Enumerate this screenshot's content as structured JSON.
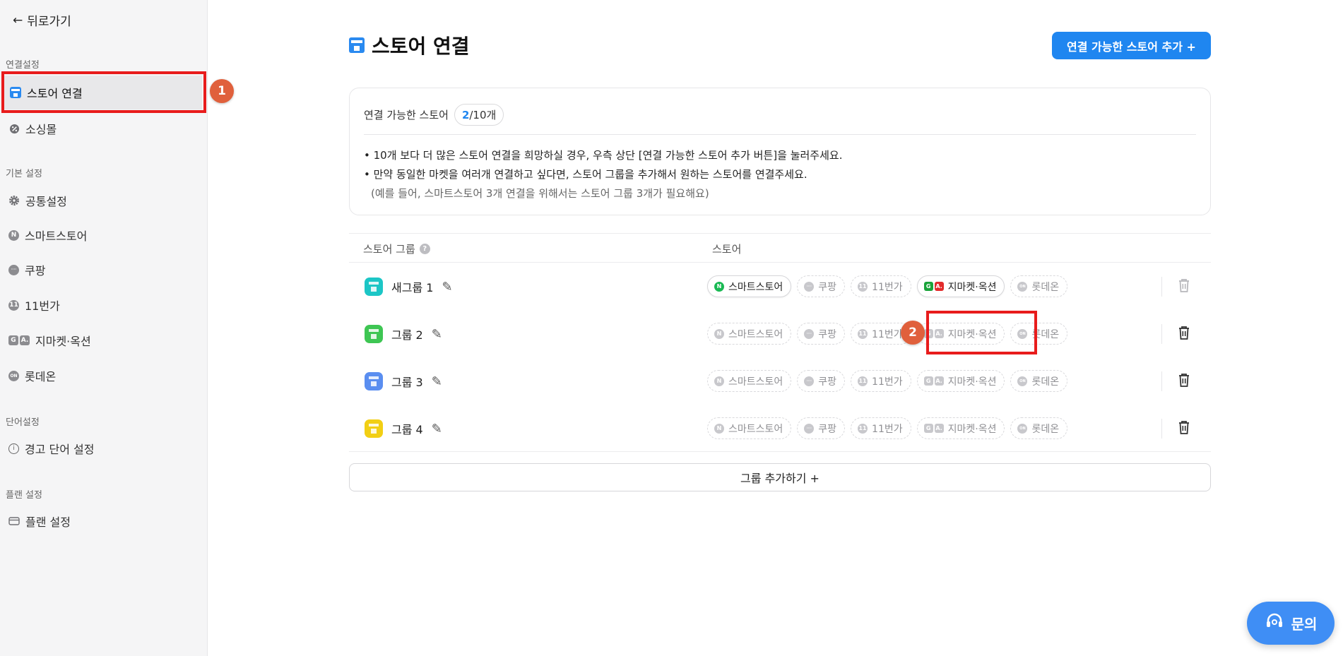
{
  "sidebar": {
    "back_label": "뒤로가기",
    "sections": [
      {
        "label": "연결설정"
      },
      {
        "label": "기본 설정"
      },
      {
        "label": "단어설정"
      },
      {
        "label": "플랜 설정"
      }
    ],
    "items": [
      {
        "label": "스토어 연결",
        "icon": "store-icon",
        "active": true
      },
      {
        "label": "소싱몰",
        "icon": "sourcing-icon"
      },
      {
        "label": "공통설정",
        "icon": "gear-icon"
      },
      {
        "label": "스마트스토어",
        "icon": "naver-icon",
        "icon_text": "N"
      },
      {
        "label": "쿠팡",
        "icon": "coupang-icon"
      },
      {
        "label": "11번가",
        "icon": "11st-icon",
        "icon_text": "11"
      },
      {
        "label": "지마켓·옥션",
        "icon": "gmarket-auction-icon",
        "icon_text": "G",
        "icon_text2": "A."
      },
      {
        "label": "롯데온",
        "icon": "lotteon-icon",
        "icon_text": "ON"
      },
      {
        "label": "경고 단어 설정",
        "icon": "info-icon",
        "icon_text": "i"
      },
      {
        "label": "플랜 설정",
        "icon": "card-icon"
      }
    ]
  },
  "annotations": {
    "marker1": "1",
    "marker2": "2"
  },
  "header": {
    "title": "스토어 연결",
    "add_button": "연결 가능한 스토어 추가 +"
  },
  "info": {
    "label": "연결 가능한 스토어",
    "current": "2",
    "max": "/10개",
    "lines": [
      "• 10개 보다 더 많은 스토어 연결을 희망하실 경우, 우측 상단 [연결 가능한 스토어 추가 버튼]을 눌러주세요.",
      "• 만약 동일한 마켓을 여러개 연결하고 싶다면, 스토어 그룹을 추가해서 원하는 스토어를 연결주세요."
    ],
    "example": "(예를 들어, 스마트스토어 3개 연결을 위해서는 스토어 그룹 3개가 필요해요)"
  },
  "table": {
    "col_group": "스토어 그룹",
    "col_group_help": "?",
    "col_store": "스토어",
    "store_labels": [
      "스마트스토어",
      "쿠팡",
      "11번가",
      "지마켓·옥션",
      "롯데온"
    ],
    "rows": [
      {
        "name": "새그룹 1",
        "color": "#1cc6c6",
        "connected": [
          "naver",
          "gmarket"
        ]
      },
      {
        "name": "그룹 2",
        "color": "#3ec653",
        "connected": []
      },
      {
        "name": "그룹 3",
        "color": "#5a8ef0",
        "connected": []
      },
      {
        "name": "그룹 4",
        "color": "#f2cf14",
        "connected": []
      }
    ]
  },
  "add_group_button": "그룹 추가하기 +",
  "inquiry_button": "문의",
  "colors": {
    "accent": "#1f86f0",
    "highlight": "#e81c1c",
    "marker": "#e0603c"
  }
}
